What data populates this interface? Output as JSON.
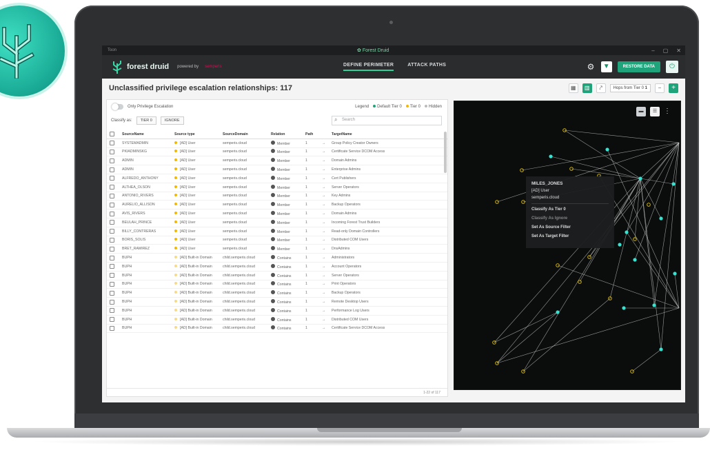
{
  "app": {
    "window_title": "Toon",
    "center_title": "Forest Druid",
    "brand_name": "forest druid",
    "powered_by": "powered by",
    "sponsor": "semperis"
  },
  "nav": {
    "tabs": [
      {
        "label": "DEFINE PERIMETER",
        "active": true
      },
      {
        "label": "ATTACK PATHS",
        "active": false
      }
    ],
    "primary_button": "RESTORE DATA"
  },
  "header": {
    "title": "Unclassified privilege escalation relationships: 117",
    "hops_label": "Hops from Tier 0",
    "hops_value": "1"
  },
  "filters": {
    "toggle_label": "Only Privilege Escalation",
    "legend_label": "Legend",
    "legend_items": [
      "Default Tier 0",
      "Tier 0",
      "Hidden"
    ],
    "classify_label": "Classify as:",
    "classify_options": [
      "TIER 0",
      "IGNORE"
    ],
    "search_placeholder": "Search"
  },
  "table": {
    "columns": [
      "SourceName",
      "Source type",
      "SourceDomain",
      "Relation",
      "Path",
      "TargetName"
    ],
    "rows": [
      {
        "source": "SYSTEMADMIN",
        "type": "[AD] User",
        "domain": "semperis.cloud",
        "rel": "Member",
        "path": "1",
        "target": "Group Policy Creator Owners",
        "tier": true
      },
      {
        "source": "PKIADMINSKG",
        "type": "[AD] User",
        "domain": "semperis.cloud",
        "rel": "Member",
        "path": "1",
        "target": "Certificate Service DCOM Access",
        "tier": true
      },
      {
        "source": "ADMIN",
        "type": "[AD] User",
        "domain": "semperis.cloud",
        "rel": "Member",
        "path": "1",
        "target": "Domain Admins",
        "tier": true
      },
      {
        "source": "ADMIN",
        "type": "[AD] User",
        "domain": "semperis.cloud",
        "rel": "Member",
        "path": "1",
        "target": "Enterprise Admins",
        "tier": true
      },
      {
        "source": "ALFREDO_ANTHONY",
        "type": "[AD] User",
        "domain": "semperis.cloud",
        "rel": "Member",
        "path": "1",
        "target": "Cert Publishers",
        "tier": true
      },
      {
        "source": "ALTHEA_OLSON",
        "type": "[AD] User",
        "domain": "semperis.cloud",
        "rel": "Member",
        "path": "1",
        "target": "Server Operators",
        "tier": true
      },
      {
        "source": "ANTONIO_RIVERS",
        "type": "[AD] User",
        "domain": "semperis.cloud",
        "rel": "Member",
        "path": "1",
        "target": "Key Admins",
        "tier": true
      },
      {
        "source": "AURELIO_ALLISON",
        "type": "[AD] User",
        "domain": "semperis.cloud",
        "rel": "Member",
        "path": "1",
        "target": "Backup Operators",
        "tier": true
      },
      {
        "source": "AVIS_RIVERS",
        "type": "[AD] User",
        "domain": "semperis.cloud",
        "rel": "Member",
        "path": "1",
        "target": "Domain Admins",
        "tier": true
      },
      {
        "source": "BEULAH_PRINCE",
        "type": "[AD] User",
        "domain": "semperis.cloud",
        "rel": "Member",
        "path": "1",
        "target": "Incoming Forest Trust Builders",
        "tier": true
      },
      {
        "source": "BILLY_CONTRERAS",
        "type": "[AD] User",
        "domain": "semperis.cloud",
        "rel": "Member",
        "path": "1",
        "target": "Read-only Domain Controllers",
        "tier": true
      },
      {
        "source": "BORIS_SOLIS",
        "type": "[AD] User",
        "domain": "semperis.cloud",
        "rel": "Member",
        "path": "1",
        "target": "Distributed COM Users",
        "tier": true
      },
      {
        "source": "BRET_RAMIREZ",
        "type": "[AD] User",
        "domain": "semperis.cloud",
        "rel": "Member",
        "path": "1",
        "target": "DnsAdmins",
        "tier": true
      },
      {
        "source": "BUPH",
        "type": "[AD] Built-in Domain",
        "domain": "child.semperis.cloud",
        "rel": "Contains",
        "path": "1",
        "target": "Administrators",
        "tier": false
      },
      {
        "source": "BUPH",
        "type": "[AD] Built-in Domain",
        "domain": "child.semperis.cloud",
        "rel": "Contains",
        "path": "1",
        "target": "Account Operators",
        "tier": false
      },
      {
        "source": "BUPH",
        "type": "[AD] Built-in Domain",
        "domain": "child.semperis.cloud",
        "rel": "Contains",
        "path": "1",
        "target": "Server Operators",
        "tier": false
      },
      {
        "source": "BUPH",
        "type": "[AD] Built-in Domain",
        "domain": "child.semperis.cloud",
        "rel": "Contains",
        "path": "1",
        "target": "Print Operators",
        "tier": false
      },
      {
        "source": "BUPH",
        "type": "[AD] Built-in Domain",
        "domain": "child.semperis.cloud",
        "rel": "Contains",
        "path": "1",
        "target": "Backup Operators",
        "tier": false
      },
      {
        "source": "BUPH",
        "type": "[AD] Built-in Domain",
        "domain": "child.semperis.cloud",
        "rel": "Contains",
        "path": "1",
        "target": "Remote Desktop Users",
        "tier": false
      },
      {
        "source": "BUPH",
        "type": "[AD] Built-in Domain",
        "domain": "child.semperis.cloud",
        "rel": "Contains",
        "path": "1",
        "target": "Performance Log Users",
        "tier": false
      },
      {
        "source": "BUPH",
        "type": "[AD] Built-in Domain",
        "domain": "child.semperis.cloud",
        "rel": "Contains",
        "path": "1",
        "target": "Distributed COM Users",
        "tier": false
      },
      {
        "source": "BUPH",
        "type": "[AD] Built-in Domain",
        "domain": "child.semperis.cloud",
        "rel": "Contains",
        "path": "1",
        "target": "Certificate Service DCOM Access",
        "tier": false
      }
    ],
    "footer_text": "1-22 of 117"
  },
  "graph": {
    "context_menu": {
      "name": "MILES_JONES",
      "type": "[AD] User",
      "domain": "semperis.cloud",
      "items": [
        {
          "label": "Classify As Tier 0",
          "enabled": true
        },
        {
          "label": "Classify As Ignore",
          "enabled": false
        },
        {
          "label": "Set As Source Filter",
          "enabled": true
        },
        {
          "label": "Set As Target Filter",
          "enabled": true
        }
      ]
    }
  },
  "colors": {
    "accent": "#1ea37a",
    "tier_dot": "#f4b600",
    "node_cyan": "#35e3d0",
    "node_yellow": "#e8c400"
  }
}
